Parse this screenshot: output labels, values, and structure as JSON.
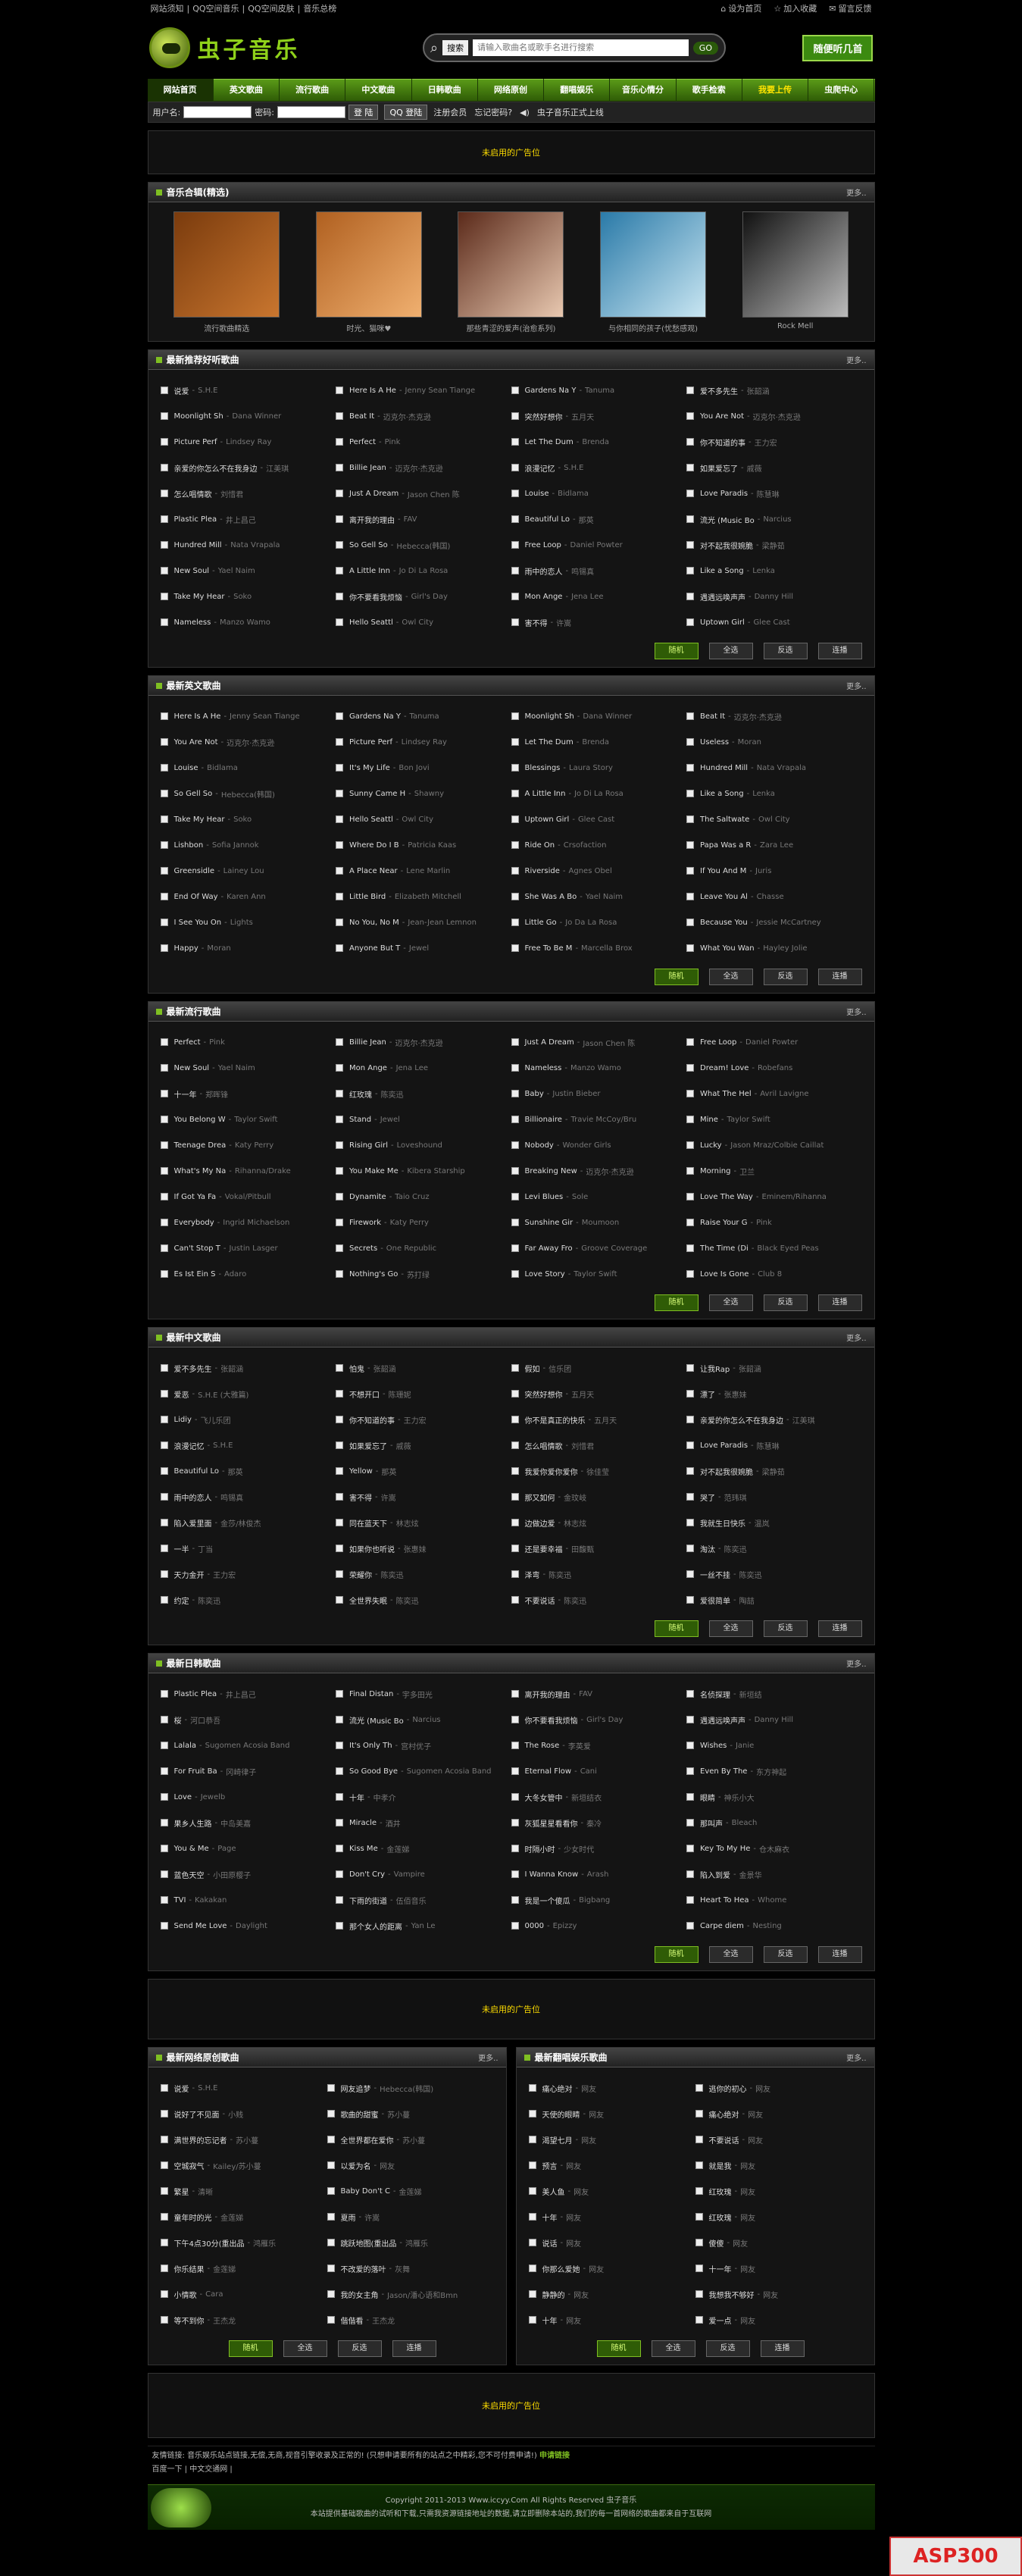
{
  "top": {
    "left": [
      "网站须知",
      "QQ空间音乐",
      "QQ空间皮肤",
      "音乐总榜"
    ],
    "right": [
      "设为首页",
      "加入收藏",
      "留言反馈"
    ]
  },
  "logo": {
    "text": "虫子音乐"
  },
  "search": {
    "button": "搜索",
    "placeholder": "请输入歌曲名或歌手名进行搜索",
    "go": "GO"
  },
  "headbtn": "随便听几首",
  "nav": [
    "网站首页",
    "英文歌曲",
    "流行歌曲",
    "中文歌曲",
    "日韩歌曲",
    "网络原创",
    "翻唱娱乐",
    "音乐心情分",
    "歌手检索",
    "我要上传",
    "虫爬中心"
  ],
  "login": {
    "user": "用户名:",
    "pass": "密码:",
    "btn": "登 陆",
    "qq": "QQ 登陆",
    "reg": "注册会员",
    "forgot": "忘记密码?",
    "notice": "虫子音乐正式上线"
  },
  "ad": "未启用的广告位",
  "albums": {
    "title": "音乐合辑(精选)",
    "more": "更多..",
    "items": [
      {
        "cap": "流行歌曲精选",
        "c1": "#7a3b0d",
        "c2": "#c9762f"
      },
      {
        "cap": "时光、猫咪♥",
        "c1": "#b06020",
        "c2": "#f0b070"
      },
      {
        "cap": "那些青涩的爱声(治愈系列)",
        "c1": "#5b2a1a",
        "c2": "#e8c8b0"
      },
      {
        "cap": "与你相同的孩子(忧愁感观)",
        "c1": "#2a7aa8",
        "c2": "#c9e6f2"
      },
      {
        "cap": "Rock Mell",
        "c1": "#111111",
        "c2": "#bbbbbb"
      }
    ]
  },
  "recommend": {
    "title": "最新推荐好听歌曲",
    "more": "更多..",
    "songs": [
      [
        "说爱",
        "S.H.E"
      ],
      [
        "Here Is A He",
        "Jenny Sean Tiange"
      ],
      [
        "Gardens Na Y",
        "Tanuma"
      ],
      [
        "爱不多先生",
        "张韶涵"
      ],
      [
        "Moonlight Sh",
        "Dana Winner"
      ],
      [
        "Beat It",
        "迈克尔·杰克逊"
      ],
      [
        "突然好想你",
        "五月天"
      ],
      [
        "You Are Not",
        "迈克尔·杰克逊"
      ],
      [
        "Picture Perf",
        "Lindsey Ray"
      ],
      [
        "Perfect",
        "Pink"
      ],
      [
        "Let The Dum",
        "Brenda"
      ],
      [
        "你不知道的事",
        "王力宏"
      ],
      [
        "亲爱的你怎么不在我身边",
        "江美琪"
      ],
      [
        "Billie Jean",
        "迈克尔·杰克逊"
      ],
      [
        "浪漫记忆",
        "S.H.E"
      ],
      [
        "如果爱忘了",
        "戚薇"
      ],
      [
        "怎么唱情歌",
        "刘惜君"
      ],
      [
        "Just A Dream",
        "Jason Chen 陈"
      ],
      [
        "Louise",
        "Bidlama"
      ],
      [
        "Love Paradis",
        "陈慧琳"
      ],
      [
        "Plastic Plea",
        "井上昌己"
      ],
      [
        "离开我的理由",
        "FAV"
      ],
      [
        "Beautiful Lo",
        "那英"
      ],
      [
        "流光 (Music Bo",
        "Narcius"
      ],
      [
        "Hundred Mill",
        "Nata Vrapala"
      ],
      [
        "So Gell So",
        "Hebecca(韩国)"
      ],
      [
        "Free Loop",
        "Daniel Powter"
      ],
      [
        "对不起我很婉脆",
        "梁静茹"
      ],
      [
        "New Soul",
        "Yael Naim"
      ],
      [
        "A Little Inn",
        "Jo Di La Rosa"
      ],
      [
        "雨中的恋人",
        "鸣锡真"
      ],
      [
        "Like a Song",
        "Lenka"
      ],
      [
        "Take My Hear",
        "Soko"
      ],
      [
        "你不要看我烦恼",
        "Girl's Day"
      ],
      [
        "Mon Ange",
        "Jena Lee"
      ],
      [
        "遇遇远唤声声",
        "Danny Hill"
      ],
      [
        "Nameless",
        "Manzo Wamo"
      ],
      [
        "Hello Seattl",
        "Owl City"
      ],
      [
        "害不得",
        "许嵩"
      ],
      [
        "Uptown Girl",
        "Glee Cast"
      ]
    ]
  },
  "english": {
    "title": "最新英文歌曲",
    "more": "更多..",
    "songs": [
      [
        "Here Is A He",
        "Jenny Sean Tiange"
      ],
      [
        "Gardens Na Y",
        "Tanuma"
      ],
      [
        "Moonlight Sh",
        "Dana Winner"
      ],
      [
        "Beat It",
        "迈克尔·杰克逊"
      ],
      [
        "You Are Not",
        "迈克尔·杰克逊"
      ],
      [
        "Picture Perf",
        "Lindsey Ray"
      ],
      [
        "Let The Dum",
        "Brenda"
      ],
      [
        "Useless",
        "Moran"
      ],
      [
        "Louise",
        "Bidlama"
      ],
      [
        "It's My Life",
        "Bon Jovi"
      ],
      [
        "Blessings",
        "Laura Story"
      ],
      [
        "Hundred Mill",
        "Nata Vrapala"
      ],
      [
        "So Gell So",
        "Hebecca(韩国)"
      ],
      [
        "Sunny Came H",
        "Shawny"
      ],
      [
        "A Little Inn",
        "Jo Di La Rosa"
      ],
      [
        "Like a Song",
        "Lenka"
      ],
      [
        "Take My Hear",
        "Soko"
      ],
      [
        "Hello Seattl",
        "Owl City"
      ],
      [
        "Uptown Girl",
        "Glee Cast"
      ],
      [
        "The Saltwate",
        "Owl City"
      ],
      [
        "Lishbon",
        "Sofia Jannok"
      ],
      [
        "Where Do I B",
        "Patricia Kaas"
      ],
      [
        "Ride On",
        "Crsofaction"
      ],
      [
        "Papa Was a R",
        "Zara Lee"
      ],
      [
        "Greensidle",
        "Lainey Lou"
      ],
      [
        "A Place Near",
        "Lene Marlin"
      ],
      [
        "Riverside",
        "Agnes Obel"
      ],
      [
        "If You And M",
        "Juris"
      ],
      [
        "End Of Way",
        "Karen Ann"
      ],
      [
        "Little Bird",
        "Elizabeth Mitchell"
      ],
      [
        "She Was A Bo",
        "Yael Naim"
      ],
      [
        "Leave You Al",
        "Chasse"
      ],
      [
        "I See You On",
        "Lights"
      ],
      [
        "No You, No M",
        "Jean-Jean Lemnon"
      ],
      [
        "Little Go",
        "Jo Da La Rosa"
      ],
      [
        "Because You",
        "Jessie McCartney"
      ],
      [
        "Happy",
        "Moran"
      ],
      [
        "Anyone But T",
        "Jewel"
      ],
      [
        "Free To Be M",
        "Marcella Brox"
      ],
      [
        "What You Wan",
        "Hayley Jolie"
      ]
    ]
  },
  "pop": {
    "title": "最新流行歌曲",
    "more": "更多..",
    "songs": [
      [
        "Perfect",
        "Pink"
      ],
      [
        "Billie Jean",
        "迈克尔·杰克逊"
      ],
      [
        "Just A Dream",
        "Jason Chen 陈"
      ],
      [
        "Free Loop",
        "Daniel Powter"
      ],
      [
        "New Soul",
        "Yael Naim"
      ],
      [
        "Mon Ange",
        "Jena Lee"
      ],
      [
        "Nameless",
        "Manzo Wamo"
      ],
      [
        "Dream! Love",
        "Robefans"
      ],
      [
        "十一年",
        "郑晖锋"
      ],
      [
        "红玫瑰",
        "陈奕迅"
      ],
      [
        "Baby",
        "Justin Bieber"
      ],
      [
        "What The Hel",
        "Avril Lavigne"
      ],
      [
        "You Belong W",
        "Taylor Swift"
      ],
      [
        "Stand",
        "Jewel"
      ],
      [
        "Billionaire",
        "Travie McCoy/Bru"
      ],
      [
        "Mine",
        "Taylor Swift"
      ],
      [
        "Teenage Drea",
        "Katy Perry"
      ],
      [
        "Rising Girl",
        "Loveshound"
      ],
      [
        "Nobody",
        "Wonder Girls"
      ],
      [
        "Lucky",
        "Jason Mraz/Colbie Caillat"
      ],
      [
        "What's My Na",
        "Rihanna/Drake"
      ],
      [
        "You Make Me",
        "Kibera Starship"
      ],
      [
        "Breaking New",
        "迈克尔·杰克逊"
      ],
      [
        "Morning",
        "卫兰"
      ],
      [
        "If Got Ya Fa",
        "Vokal/Pitbull"
      ],
      [
        "Dynamite",
        "Taio Cruz"
      ],
      [
        "Levi Blues",
        "Sole"
      ],
      [
        "Love The Way",
        "Eminem/Rihanna"
      ],
      [
        "Everybody",
        "Ingrid Michaelson"
      ],
      [
        "Firework",
        "Katy Perry"
      ],
      [
        "Sunshine Gir",
        "Moumoon"
      ],
      [
        "Raise Your G",
        "Pink"
      ],
      [
        "Can't Stop T",
        "Justin Lasger"
      ],
      [
        "Secrets",
        "One Republic"
      ],
      [
        "Far Away Fro",
        "Groove Coverage"
      ],
      [
        "The Time (Di",
        "Black Eyed Peas"
      ],
      [
        "Es Ist Ein S",
        "Adaro"
      ],
      [
        "Nothing's Go",
        "苏打绿"
      ],
      [
        "Love Story",
        "Taylor Swift"
      ],
      [
        "Love Is Gone",
        "Club 8"
      ]
    ]
  },
  "chinese": {
    "title": "最新中文歌曲",
    "more": "更多..",
    "songs": [
      [
        "爱不多先生",
        "张韶涵"
      ],
      [
        "怕鬼",
        "张韶涵"
      ],
      [
        "假如",
        "信乐团"
      ],
      [
        "让我Rap",
        "张韶涵"
      ],
      [
        "爱恶",
        "S.H.E (大雅篇)"
      ],
      [
        "不想开口",
        "陈珊妮"
      ],
      [
        "突然好想你",
        "五月天"
      ],
      [
        "漂了",
        "张惠妹"
      ],
      [
        "Lidiy",
        "飞儿乐团"
      ],
      [
        "你不知道的事",
        "王力宏"
      ],
      [
        "你不是真正的快乐",
        "五月天"
      ],
      [
        "亲爱的你怎么不在我身边",
        "江美琪"
      ],
      [
        "浪漫记忆",
        "S.H.E"
      ],
      [
        "如果爱忘了",
        "戚薇"
      ],
      [
        "怎么唱情歌",
        "刘惜君"
      ],
      [
        "Love Paradis",
        "陈慧琳"
      ],
      [
        "Beautiful Lo",
        "那英"
      ],
      [
        "Yellow",
        "那英"
      ],
      [
        "我爱你爱你爱你",
        "徐佳莹"
      ],
      [
        "对不起我很婉脆",
        "梁静茹"
      ],
      [
        "雨中的恋人",
        "鸣锡真"
      ],
      [
        "害不得",
        "许嵩"
      ],
      [
        "那又如何",
        "金玟岐"
      ],
      [
        "哭了",
        "范玮琪"
      ],
      [
        "陷入爱里面",
        "金莎/林俊杰"
      ],
      [
        "同在蓝天下",
        "林志炫"
      ],
      [
        "边做边爱",
        "林志炫"
      ],
      [
        "我就生日快乐",
        "温岚"
      ],
      [
        "一半",
        "丁当"
      ],
      [
        "如果你也听说",
        "张惠妹"
      ],
      [
        "还是要幸福",
        "田馥甄"
      ],
      [
        "淘汰",
        "陈奕迅"
      ],
      [
        "天力金开",
        "王力宏"
      ],
      [
        "荣耀你",
        "陈奕迅"
      ],
      [
        "泽弯",
        "陈奕迅"
      ],
      [
        "一丝不挂",
        "陈奕迅"
      ],
      [
        "约定",
        "陈奕迅"
      ],
      [
        "全世界失眠",
        "陈奕迅"
      ],
      [
        "不要说话",
        "陈奕迅"
      ],
      [
        "爱很简单",
        "陶喆"
      ]
    ]
  },
  "jpkr": {
    "title": "最新日韩歌曲",
    "more": "更多..",
    "songs": [
      [
        "Plastic Plea",
        "井上昌己"
      ],
      [
        "Final Distan",
        "宇多田光"
      ],
      [
        "离开我的理由",
        "FAV"
      ],
      [
        "名侦探理",
        "新垣结"
      ],
      [
        "桜",
        "河口恭吾"
      ],
      [
        "流光 (Music Bo",
        "Narcius"
      ],
      [
        "你不要看我烦恼",
        "Girl's Day"
      ],
      [
        "遇遇远唤声声",
        "Danny Hill"
      ],
      [
        "Lalala",
        "Sugomen Acosia Band"
      ],
      [
        "It's Only Th",
        "宫村优子"
      ],
      [
        "The Rose",
        "李英爱"
      ],
      [
        "Wishes",
        "Janie"
      ],
      [
        "For Fruit Ba",
        "冈崎律子"
      ],
      [
        "So Good Bye",
        "Sugomen Acosia Band"
      ],
      [
        "Eternal Flow",
        "Cani"
      ],
      [
        "Even By The",
        "东方神起"
      ],
      [
        "Love",
        "Jewelb"
      ],
      [
        "十年",
        "中孝介"
      ],
      [
        "大冬女管中",
        "新垣结衣"
      ],
      [
        "眼睛",
        "神乐小大"
      ],
      [
        "果乡人生路",
        "中岛美嘉"
      ],
      [
        "Miracle",
        "酒井"
      ],
      [
        "灰狐星星看看你",
        "秦冷"
      ],
      [
        "那叫声",
        "Bleach"
      ],
      [
        "You & Me",
        "Page"
      ],
      [
        "Kiss Me",
        "金莲娣"
      ],
      [
        "时隔小时",
        "少女时代"
      ],
      [
        "Key To My He",
        "仓木麻衣"
      ],
      [
        "蓝色天空",
        "小田原樱子"
      ],
      [
        "Don't Cry",
        "Vampire"
      ],
      [
        "I Wanna Know",
        "Arash"
      ],
      [
        "陷入到爱",
        "金景华"
      ],
      [
        "TVI",
        "Kakakan"
      ],
      [
        "下雨的街道",
        "伍佰音乐"
      ],
      [
        "我是一个傻瓜",
        "Bigbang"
      ],
      [
        "Heart To Hea",
        "Whome"
      ],
      [
        "Send Me Love",
        "Daylight"
      ],
      [
        "那个女人的距离",
        "Yan Le"
      ],
      [
        "0000",
        "Epizzy"
      ],
      [
        "Carpe diem",
        "Nesting"
      ]
    ]
  },
  "original": {
    "title": "最新网络原创歌曲",
    "more": "更多..",
    "songs": [
      [
        "说爱",
        "S.H.E"
      ],
      [
        "网友追梦",
        "Hebecca(韩国)"
      ],
      [
        "说好了不见面",
        "小贱"
      ],
      [
        "歌曲的甜蜜",
        "苏小蔓"
      ],
      [
        "满世界的忘记者",
        "苏小蔓"
      ],
      [
        "全世界都在爱你",
        "苏小蔓"
      ],
      [
        "空城寂气",
        "Kailey/苏小蔓"
      ],
      [
        "以爱为名",
        "网友"
      ],
      [
        "繁星",
        "清晰"
      ],
      [
        "Baby Don't C",
        "金莲娣"
      ],
      [
        "童年时的光",
        "金莲娣"
      ],
      [
        "夏雨",
        "许嵩"
      ],
      [
        "下午4点30分(重出品",
        "鸿雁乐"
      ],
      [
        "跳跃地图(重出品",
        "鸿雁乐"
      ],
      [
        "你乐结果",
        "金莲娣"
      ],
      [
        "不改爱的落叶",
        "灰舞"
      ],
      [
        "小情歌",
        "Cara"
      ],
      [
        "我的女主角",
        "Jason/潘心语和Bmn"
      ],
      [
        "等不到你",
        "王杰龙"
      ],
      [
        "偕偕看",
        "王杰龙"
      ]
    ]
  },
  "cover": {
    "title": "最新翻唱娱乐歌曲",
    "more": "更多..",
    "songs": [
      [
        "痛心绝对",
        "网友"
      ],
      [
        "逃你的初心",
        "网友"
      ],
      [
        "天使的眼睛",
        "网友"
      ],
      [
        "痛心绝对",
        "网友"
      ],
      [
        "渴望七月",
        "网友"
      ],
      [
        "不要说话",
        "网友"
      ],
      [
        "预言",
        "网友"
      ],
      [
        "就是我",
        "网友"
      ],
      [
        "美人鱼",
        "网友"
      ],
      [
        "红玫瑰",
        "网友"
      ],
      [
        "十年",
        "网友"
      ],
      [
        "红玫瑰",
        "网友"
      ],
      [
        "说话",
        "网友"
      ],
      [
        "傻傻",
        "网友"
      ],
      [
        "你那么爱她",
        "网友"
      ],
      [
        "十一年",
        "网友"
      ],
      [
        "静静的",
        "网友"
      ],
      [
        "我想我不够好",
        "网友"
      ],
      [
        "十年",
        "网友"
      ],
      [
        "爱一点",
        "网友"
      ]
    ]
  },
  "actions": {
    "rand": "随机",
    "all": "全选",
    "inv": "反选",
    "play": "连播"
  },
  "links": {
    "label": "友情链接:",
    "text": "音乐娱乐站点链接,无偿,无商,视音引擎收录及正常的! (只想申请要所有的站点之中精彩,您不可付费申请!)",
    "apply": "申请链接",
    "line2": "百度一下 | 中文交通网 |"
  },
  "footer": {
    "copy": "Copyright 2011-2013 Www.iccyy.Com All Rights Reserved 虫子音乐",
    "note": "本站提供基础歌曲的试听和下载,只需我资源链接地址的数据,请立即删除本站的,我们的每一首网络的歌曲都来自于互联网"
  },
  "watermark": "ASP300"
}
